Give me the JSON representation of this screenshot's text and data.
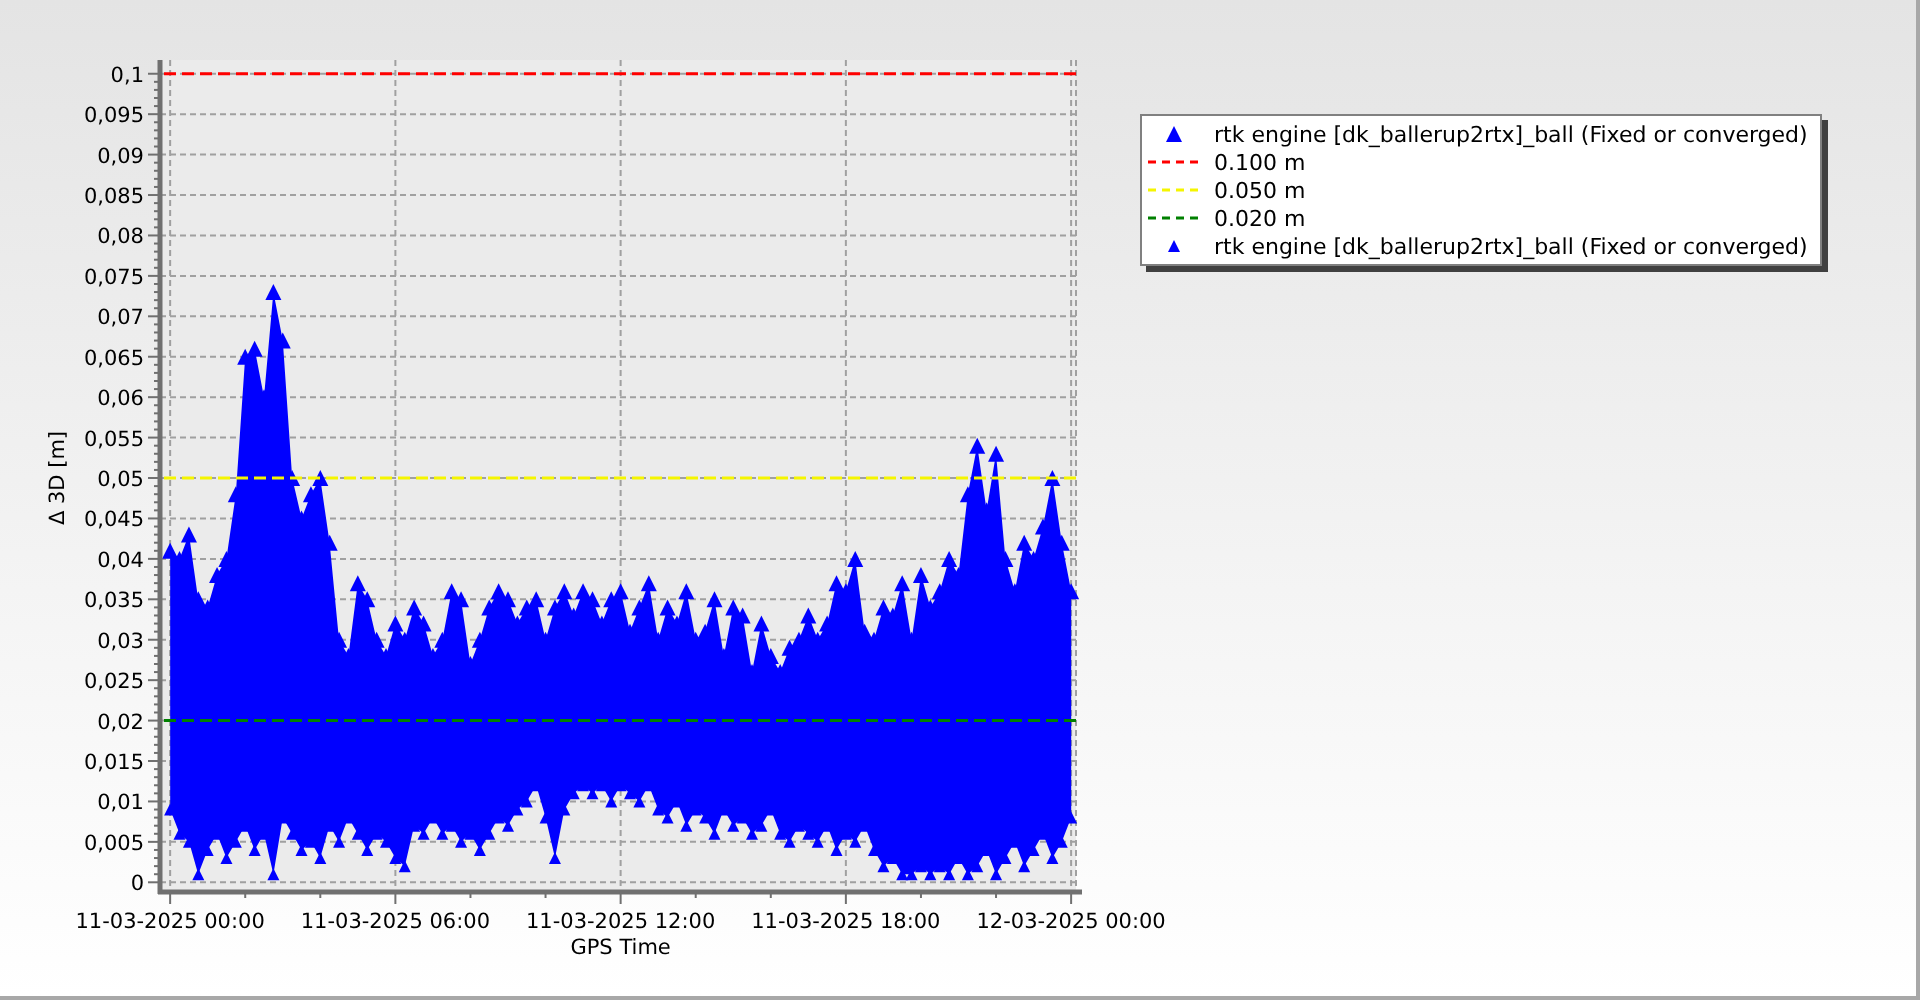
{
  "chart": {
    "chart_data": {
      "type": "scatter",
      "xlabel": "GPS Time",
      "ylabel": "Δ 3D [m]",
      "grid": true,
      "ylim": [
        -0.0012,
        0.1017
      ],
      "yticks": [
        {
          "value": 0,
          "label": "0"
        },
        {
          "value": 0.005,
          "label": "0,005"
        },
        {
          "value": 0.01,
          "label": "0,01"
        },
        {
          "value": 0.015,
          "label": "0,015"
        },
        {
          "value": 0.02,
          "label": "0,02"
        },
        {
          "value": 0.025,
          "label": "0,025"
        },
        {
          "value": 0.03,
          "label": "0,03"
        },
        {
          "value": 0.035,
          "label": "0,035"
        },
        {
          "value": 0.04,
          "label": "0,04"
        },
        {
          "value": 0.045,
          "label": "0,045"
        },
        {
          "value": 0.05,
          "label": "0,05"
        },
        {
          "value": 0.055,
          "label": "0,055"
        },
        {
          "value": 0.06,
          "label": "0,06"
        },
        {
          "value": 0.065,
          "label": "0,065"
        },
        {
          "value": 0.07,
          "label": "0,07"
        },
        {
          "value": 0.075,
          "label": "0,075"
        },
        {
          "value": 0.08,
          "label": "0,08"
        },
        {
          "value": 0.085,
          "label": "0,085"
        },
        {
          "value": 0.09,
          "label": "0,09"
        },
        {
          "value": 0.095,
          "label": "0,095"
        },
        {
          "value": 0.1,
          "label": "0,1"
        }
      ],
      "categories": [
        "11-03-2025 00:00",
        null,
        null,
        null,
        null,
        null,
        null,
        null,
        null,
        null,
        null,
        null,
        null,
        null,
        null,
        null,
        null,
        null,
        null,
        null,
        null,
        null,
        null,
        null,
        "11-03-2025 06:00",
        null,
        null,
        null,
        null,
        null,
        null,
        null,
        null,
        null,
        null,
        null,
        null,
        null,
        null,
        null,
        null,
        null,
        null,
        null,
        null,
        null,
        null,
        null,
        "11-03-2025 12:00",
        null,
        null,
        null,
        null,
        null,
        null,
        null,
        null,
        null,
        null,
        null,
        null,
        null,
        null,
        null,
        null,
        null,
        null,
        null,
        null,
        null,
        null,
        null,
        "11-03-2025 18:00",
        null,
        null,
        null,
        null,
        null,
        null,
        null,
        null,
        null,
        null,
        null,
        null,
        null,
        null,
        null,
        null,
        null,
        null,
        null,
        null,
        null,
        null,
        null,
        "12-03-2025 00:00"
      ],
      "series": [
        {
          "name": "rtk engine [dk_ballerup2rtx]_ball (Fixed or converged)",
          "color": "#0000ff",
          "marker": "triangle",
          "values": [
            0.041,
            0.04,
            0.043,
            0.035,
            0.034,
            0.038,
            0.04,
            0.048,
            0.065,
            0.066,
            0.06,
            0.073,
            0.067,
            0.05,
            0.045,
            0.048,
            0.05,
            0.042,
            0.03,
            0.028,
            0.037,
            0.035,
            0.03,
            0.028,
            0.032,
            0.03,
            0.034,
            0.032,
            0.028,
            0.03,
            0.036,
            0.035,
            0.027,
            0.03,
            0.034,
            0.036,
            0.035,
            0.032,
            0.034,
            0.035,
            0.03,
            0.034,
            0.036,
            0.033,
            0.036,
            0.035,
            0.032,
            0.035,
            0.036,
            0.031,
            0.034,
            0.037,
            0.03,
            0.034,
            0.032,
            0.036,
            0.03,
            0.031,
            0.035,
            0.028,
            0.034,
            0.033,
            0.026,
            0.032,
            0.028,
            0.026,
            0.029,
            0.03,
            0.033,
            0.03,
            0.032,
            0.037,
            0.036,
            0.04,
            0.031,
            0.03,
            0.034,
            0.033,
            0.037,
            0.03,
            0.038,
            0.034,
            0.036,
            0.04,
            0.038,
            0.048,
            0.054,
            0.046,
            0.053,
            0.04,
            0.036,
            0.042,
            0.04,
            0.044,
            0.05,
            0.042,
            0.036
          ]
        },
        {
          "name": "rtk engine [dk_ballerup2rtx]_ball (Fixed or converged)",
          "color": "#0000ff",
          "marker": "triangle",
          "values": [
            0.009,
            0.006,
            0.005,
            0.001,
            0.004,
            0.006,
            0.003,
            0.005,
            0.007,
            0.004,
            0.006,
            0.001,
            0.008,
            0.006,
            0.004,
            0.005,
            0.003,
            0.007,
            0.005,
            0.008,
            0.006,
            0.004,
            0.006,
            0.005,
            0.003,
            0.002,
            0.007,
            0.006,
            0.008,
            0.006,
            0.007,
            0.005,
            0.006,
            0.004,
            0.006,
            0.008,
            0.007,
            0.009,
            0.01,
            0.012,
            0.008,
            0.003,
            0.009,
            0.011,
            0.012,
            0.011,
            0.012,
            0.01,
            0.012,
            0.011,
            0.01,
            0.012,
            0.009,
            0.008,
            0.01,
            0.007,
            0.009,
            0.008,
            0.006,
            0.009,
            0.007,
            0.008,
            0.006,
            0.007,
            0.009,
            0.006,
            0.005,
            0.007,
            0.006,
            0.005,
            0.007,
            0.004,
            0.006,
            0.005,
            0.007,
            0.004,
            0.002,
            0.003,
            0.001,
            0.001,
            0.002,
            0.001,
            0.002,
            0.001,
            0.003,
            0.001,
            0.002,
            0.004,
            0.001,
            0.003,
            0.005,
            0.002,
            0.004,
            0.006,
            0.003,
            0.005,
            0.008
          ]
        }
      ],
      "ref_lines": [
        {
          "axis": "y",
          "value": 0.1,
          "label": "0.100 m",
          "color": "#ff0000"
        },
        {
          "axis": "y",
          "value": 0.05,
          "label": "0.050 m",
          "color": "#f5f500"
        },
        {
          "axis": "y",
          "value": 0.02,
          "label": "0.020 m",
          "color": "#008000"
        }
      ]
    }
  }
}
